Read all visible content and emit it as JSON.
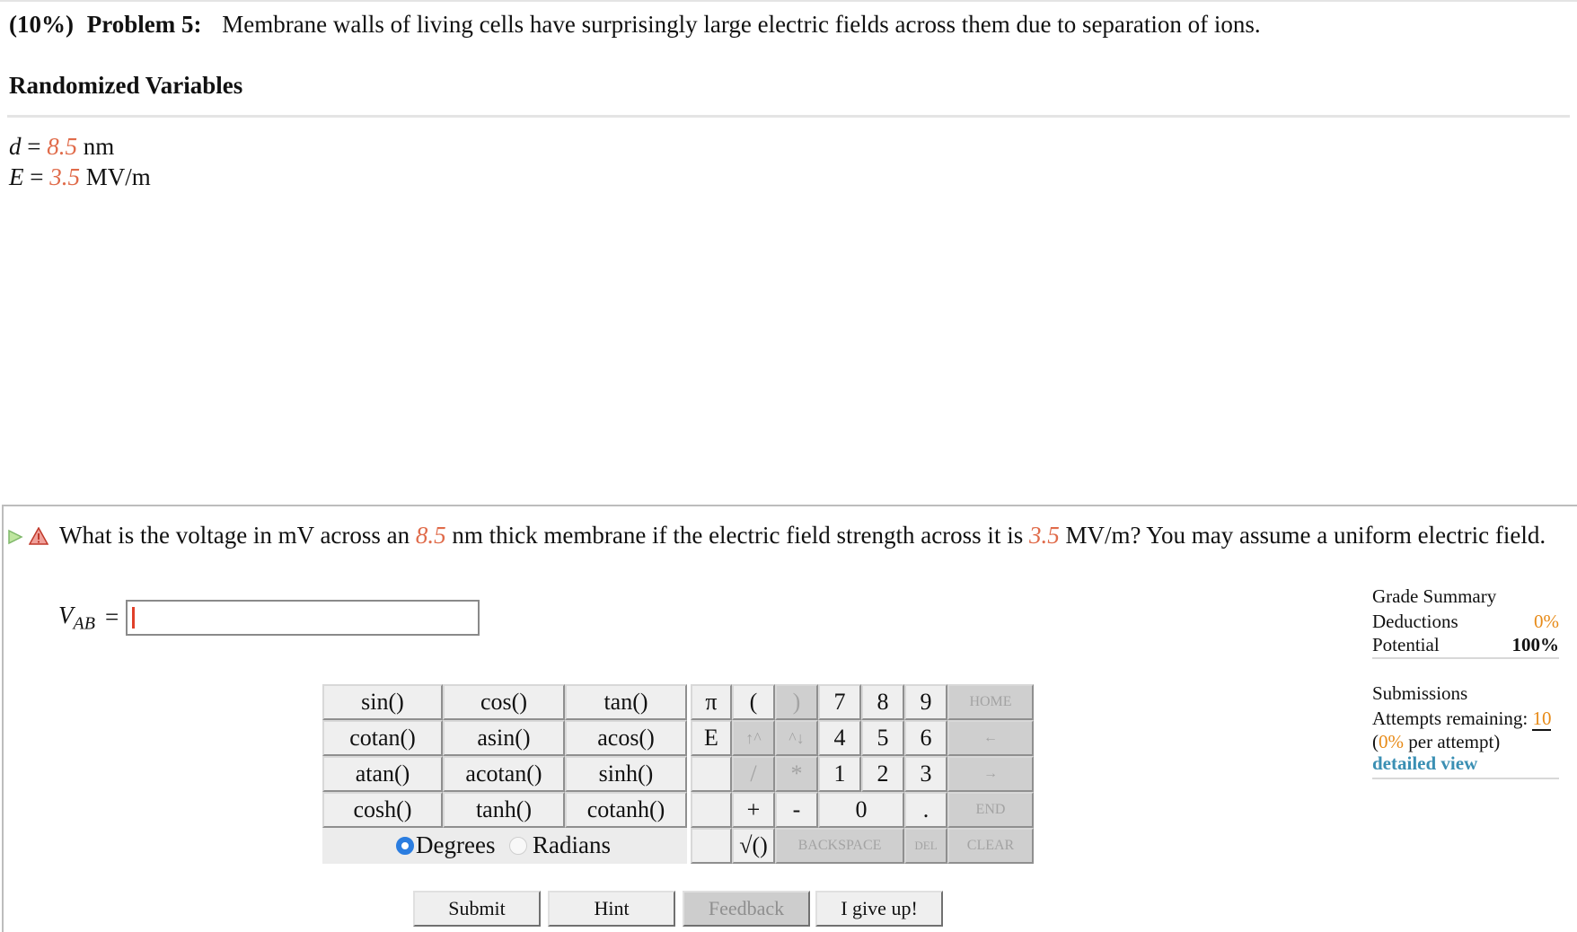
{
  "problem": {
    "weight": "(10%)",
    "label": "Problem 5:",
    "statement": "Membrane walls of living cells have surprisingly large electric fields across them due to separation of ions."
  },
  "randomized": {
    "title": "Randomized Variables",
    "vars": [
      {
        "symbol": "d",
        "eq": " = ",
        "value": "8.5",
        "unit": " nm"
      },
      {
        "symbol": "E",
        "eq": " = ",
        "value": "3.5",
        "unit": " MV/m"
      }
    ]
  },
  "question": {
    "t1": "What is the voltage in mV across an ",
    "v1": "8.5",
    "t2": " nm thick membrane if the electric field strength across it is ",
    "v2": "3.5",
    "t3": " MV/m? You may assume a uniform electric field."
  },
  "answer": {
    "var": "V",
    "sub": "AB",
    "eq": "=",
    "value": ""
  },
  "keypad": {
    "functions": [
      [
        "sin()",
        "cos()",
        "tan()"
      ],
      [
        "cotan()",
        "asin()",
        "acos()"
      ],
      [
        "atan()",
        "acotan()",
        "sinh()"
      ],
      [
        "cosh()",
        "tanh()",
        "cotanh()"
      ]
    ],
    "pi": "π",
    "e": "E",
    "lparen": "(",
    "rparen": ")",
    "up": "↑^",
    "down": "^↓",
    "div": "/",
    "mul": "*",
    "plus": "+",
    "minus": "-",
    "sqrt": "√()",
    "digits": [
      "7",
      "8",
      "9",
      "4",
      "5",
      "6",
      "1",
      "2",
      "3",
      "0",
      "."
    ],
    "home": "HOME",
    "left": "←",
    "right": "→",
    "end": "END",
    "backspace": "BACKSPACE",
    "del": "DEL",
    "clear": "CLEAR",
    "degrees": "Degrees",
    "radians": "Radians",
    "angle_mode": "Degrees"
  },
  "buttons": {
    "submit": "Submit",
    "hint": "Hint",
    "feedback": "Feedback",
    "give_up": "I give up!"
  },
  "grade_summary": {
    "title": "Grade Summary",
    "deductions_label": "Deductions",
    "deductions_value": "0%",
    "potential_label": "Potential",
    "potential_value": "100%",
    "submissions_title": "Submissions",
    "attempts_label": "Attempts remaining: ",
    "attempts_value": "10",
    "per_open": "(",
    "per_value": "0%",
    "per_text": " per attempt)",
    "detailed": "detailed view"
  },
  "colors": {
    "variable": "#e06b4a",
    "accent_orange": "#e78a17",
    "link": "#3a8fb3",
    "radio_selected": "#2b7de0"
  }
}
